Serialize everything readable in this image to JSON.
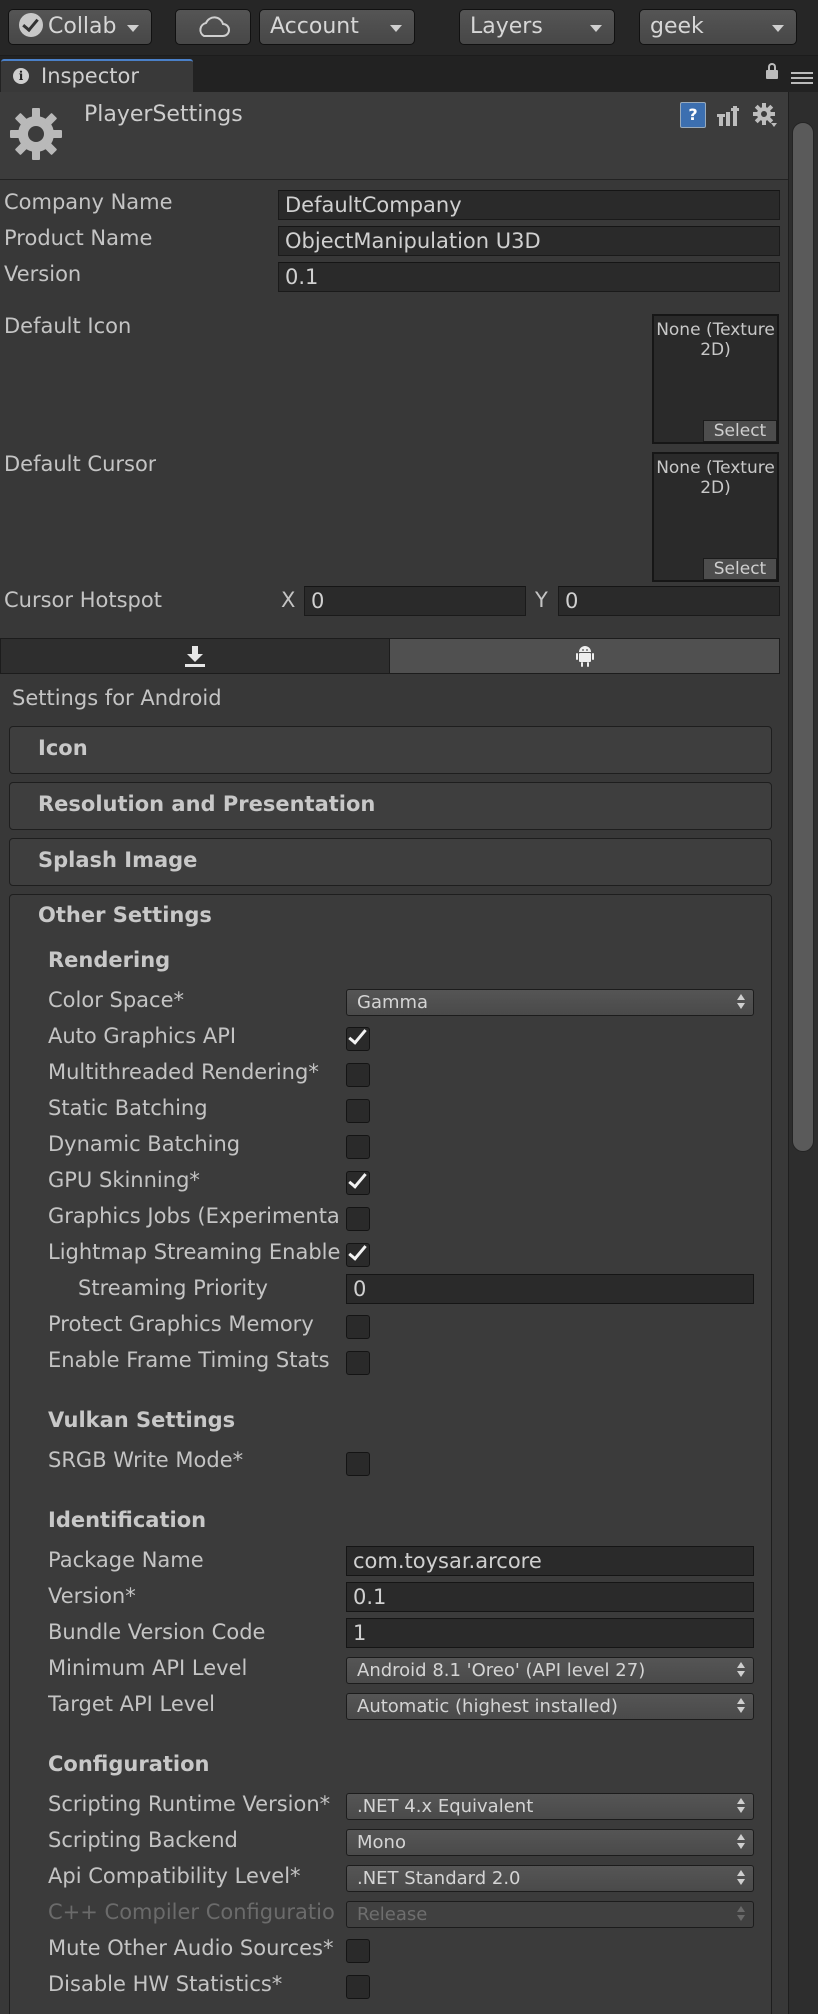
{
  "toolbar": {
    "collab_label": "Collab",
    "account_label": "Account",
    "layers_label": "Layers",
    "layout_label": "geek"
  },
  "tab": {
    "label": "Inspector"
  },
  "header": {
    "title": "PlayerSettings"
  },
  "player": {
    "company_name_label": "Company Name",
    "company_name_value": "DefaultCompany",
    "product_name_label": "Product Name",
    "product_name_value": "ObjectManipulation U3D",
    "version_label": "Version",
    "version_value": "0.1",
    "default_icon_label": "Default Icon",
    "default_icon_value": "None (Texture 2D)",
    "default_cursor_label": "Default Cursor",
    "default_cursor_value": "None (Texture 2D)",
    "select_label": "Select",
    "cursor_hotspot_label": "Cursor Hotspot",
    "hotspot_x_label": "X",
    "hotspot_x_value": "0",
    "hotspot_y_label": "Y",
    "hotspot_y_value": "0"
  },
  "settings_title": "Settings for Android",
  "foldouts": {
    "icon": "Icon",
    "resolution": "Resolution and Presentation",
    "splash": "Splash Image",
    "other": "Other Settings"
  },
  "rendering": {
    "heading": "Rendering",
    "color_space_label": "Color Space*",
    "color_space_value": "Gamma",
    "auto_graphics_label": "Auto Graphics API",
    "auto_graphics_checked": true,
    "multithreaded_label": "Multithreaded Rendering*",
    "multithreaded_checked": false,
    "static_batching_label": "Static Batching",
    "static_batching_checked": false,
    "dynamic_batching_label": "Dynamic Batching",
    "dynamic_batching_checked": false,
    "gpu_skinning_label": "GPU Skinning*",
    "gpu_skinning_checked": true,
    "graphics_jobs_label": "Graphics Jobs (Experimenta",
    "graphics_jobs_checked": false,
    "lightmap_streaming_label": "Lightmap Streaming Enable",
    "lightmap_streaming_checked": true,
    "streaming_priority_label": "Streaming Priority",
    "streaming_priority_value": "0",
    "protect_memory_label": "Protect Graphics Memory",
    "protect_memory_checked": false,
    "frame_timing_label": "Enable Frame Timing Stats",
    "frame_timing_checked": false
  },
  "vulkan": {
    "heading": "Vulkan Settings",
    "srgb_label": "SRGB Write Mode*",
    "srgb_checked": false
  },
  "identification": {
    "heading": "Identification",
    "package_name_label": "Package Name",
    "package_name_value": "com.toysar.arcore",
    "version_label": "Version*",
    "version_value": "0.1",
    "bundle_code_label": "Bundle Version Code",
    "bundle_code_value": "1",
    "min_api_label": "Minimum API Level",
    "min_api_value": "Android 8.1 'Oreo' (API level 27)",
    "target_api_label": "Target API Level",
    "target_api_value": "Automatic (highest installed)"
  },
  "configuration": {
    "heading": "Configuration",
    "runtime_label": "Scripting Runtime Version*",
    "runtime_value": ".NET 4.x Equivalent",
    "backend_label": "Scripting Backend",
    "backend_value": "Mono",
    "api_compat_label": "Api Compatibility Level*",
    "api_compat_value": ".NET Standard 2.0",
    "cpp_config_label": "C++ Compiler Configuratio",
    "cpp_config_value": "Release",
    "mute_audio_label": "Mute Other Audio Sources*",
    "mute_audio_checked": false,
    "disable_hw_label": "Disable HW Statistics*",
    "disable_hw_checked": false
  }
}
